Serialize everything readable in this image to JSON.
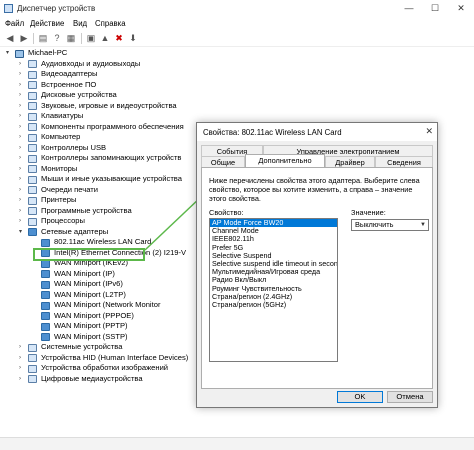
{
  "window": {
    "title": "Диспетчер устройств",
    "controls": {
      "minimize": "—",
      "maximize": "☐",
      "close": "✕"
    }
  },
  "menu": [
    "Файл",
    "Действие",
    "Вид",
    "Справка"
  ],
  "toolbar": [
    "back-icon",
    "forward-icon",
    "properties-icon",
    "help-icon",
    "update-icon",
    "scan-icon",
    "remove-icon",
    "download-icon"
  ],
  "tree": {
    "root": "Michael-PC",
    "items": [
      "Аудиовходы и аудиовыходы",
      "Видеоадаптеры",
      "Встроенное ПО",
      "Дисковые устройства",
      "Звуковые, игровые и видеоустройства",
      "Клавиатуры",
      "Компоненты программного обеспечения",
      "Компьютер",
      "Контроллеры USB",
      "Контроллеры запоминающих устройств",
      "Мониторы",
      "Мыши и иные указывающие устройства",
      "Очереди печати",
      "Принтеры",
      "Программные устройства",
      "Процессоры",
      "Сетевые адаптеры"
    ],
    "network_children": [
      "802.11ac Wireless LAN Card",
      "Intel(R) Ethernet Connection (2) I219-V",
      "WAN Miniport (IKEv2)",
      "WAN Miniport (IP)",
      "WAN Miniport (IPv6)",
      "WAN Miniport (L2TP)",
      "WAN Miniport (Network Monitor",
      "WAN Miniport (PPPOE)",
      "WAN Miniport (PPTP)",
      "WAN Miniport (SSTP)"
    ],
    "after_items": [
      "Системные устройства",
      "Устройства HID (Human Interface Devices)",
      "Устройства обработки изображений",
      "Цифровые медиаустройства"
    ]
  },
  "dialog": {
    "title": "Свойства: 802.11ac Wireless LAN Card",
    "close": "✕",
    "tabs_top": [
      "События",
      "Управление электропитанием"
    ],
    "tabs_bottom": [
      "Общие",
      "Дополнительно",
      "Драйвер",
      "Сведения"
    ],
    "active_tab": "Дополнительно",
    "description": "Ниже перечислены свойства этого адаптера. Выберите слева свойство, которое вы хотите изменить, а справа – значение этого свойства.",
    "property_label": "Свойство:",
    "value_label": "Значение:",
    "properties": [
      "AP Mode Force BW20",
      "Channel Mode",
      "IEEE802.11h",
      "Prefer 5G",
      "Selective Suspend",
      "Selective suspend idle timeout in seconds",
      "Мультимедийная/Игровая среда",
      "Радио Вкл/Выкл",
      "Роуминг Чувствительность",
      "Страна/регион (2.4GHz)",
      "Страна/регион (5GHz)"
    ],
    "selected_property": "AP Mode Force BW20",
    "value": "Выключить",
    "ok_label": "OK",
    "cancel_label": "Отмена"
  }
}
